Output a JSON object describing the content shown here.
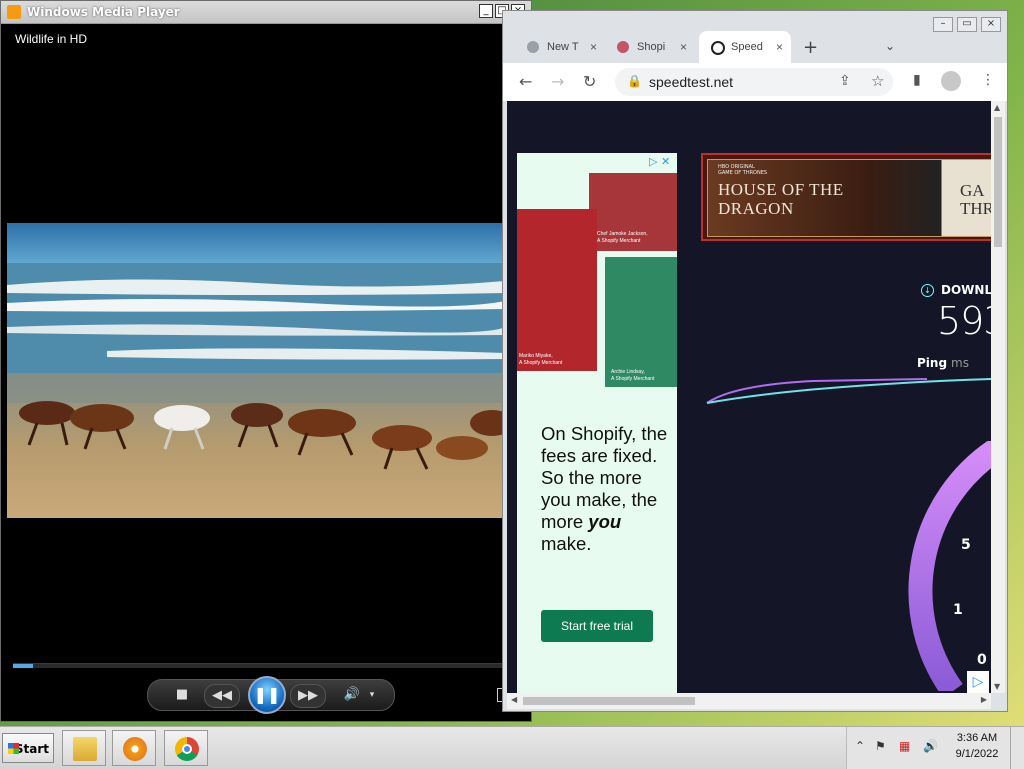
{
  "wmp": {
    "window_title": "Windows Media Player",
    "media_title": "Wildlife in HD",
    "progress": 0.04,
    "controls": {
      "stop": "■",
      "rewind": "◀◀",
      "play_pause": "❚❚",
      "fast_forward": "▶▶",
      "volume": "🔊",
      "volume_menu": "▾"
    }
  },
  "chrome": {
    "tabs": [
      {
        "label": "New T",
        "close": "×",
        "active": false
      },
      {
        "label": "Shopi",
        "close": "×",
        "active": false
      },
      {
        "label": "Speed",
        "close": "×",
        "active": true
      }
    ],
    "new_tab": "+",
    "tab_menu": "⌄",
    "url": "speedtest.net",
    "window_buttons": {
      "min": "–",
      "max": "▭",
      "close": "×"
    }
  },
  "page": {
    "ad": {
      "caption1_name": "Chef Jamoke Jackson,",
      "caption1_role": "A Shopify Merchant",
      "caption2_name": "Mariko Miyake,",
      "caption2_role": "A Shopify Merchant",
      "caption3_name": "Archie Lindsay,",
      "caption3_role": "A Shopify Merchant",
      "copy_before": "On Shopify, the fees are fixed. So the more you make, the more ",
      "copy_emphasis": "you",
      "copy_after": " make.",
      "cta": "Start free trial"
    },
    "banner": {
      "hbo": "HBO ORIGINAL",
      "got": "GAME OF THRONES",
      "title_line1": "HOUSE OF THE",
      "title_line2": "DRAGON",
      "right_text_line1": "GA",
      "right_text_line2": "THR"
    },
    "speedtest": {
      "download_label": "DOWNL",
      "download_value": "593",
      "ping_label": "Ping",
      "ping_unit": "ms",
      "gauge_ticks": [
        "5",
        "1",
        "0"
      ]
    }
  },
  "taskbar": {
    "start_label": "Start",
    "time": "3:36 AM",
    "date": "9/1/2022",
    "tray_overflow": "⌃"
  },
  "colors": {
    "speedtest_bg": "#141526",
    "shopify_green": "#0e7a52",
    "gauge_purple": "#b16cf0",
    "graph_cyan": "#6fe3e8"
  }
}
